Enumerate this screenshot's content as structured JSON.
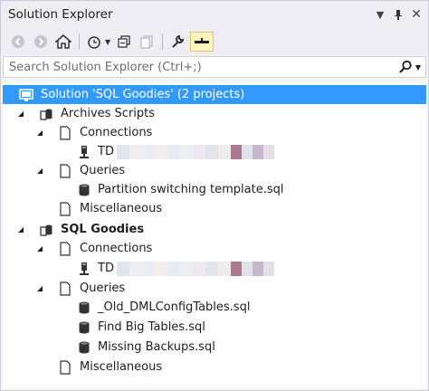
{
  "window": {
    "title": "Solution Explorer"
  },
  "title_buttons": [
    "dropdown-icon",
    "pin-icon",
    "close-icon"
  ],
  "search": {
    "placeholder": "Search Solution Explorer (Ctrl+;)"
  },
  "colors": {
    "selection": "#3399ff",
    "active_tool": "#fdf4bf",
    "panel_bg": "#eeeef2"
  },
  "tree": {
    "solution": "Solution 'SQL Goodies' (2 projects)",
    "project1": {
      "name": "Archives Scripts",
      "connections": "Connections",
      "connection_item": "TD",
      "queries": "Queries",
      "query_items": [
        "Partition switching template.sql"
      ],
      "misc": "Miscellaneous"
    },
    "project2": {
      "name": "SQL Goodies",
      "connections": "Connections",
      "connection_item": "TD",
      "queries": "Queries",
      "query_items": [
        "_Old_DMLConfigTables.sql",
        "Find Big Tables.sql",
        "Missing Backups.sql"
      ],
      "misc": "Miscellaneous"
    }
  }
}
